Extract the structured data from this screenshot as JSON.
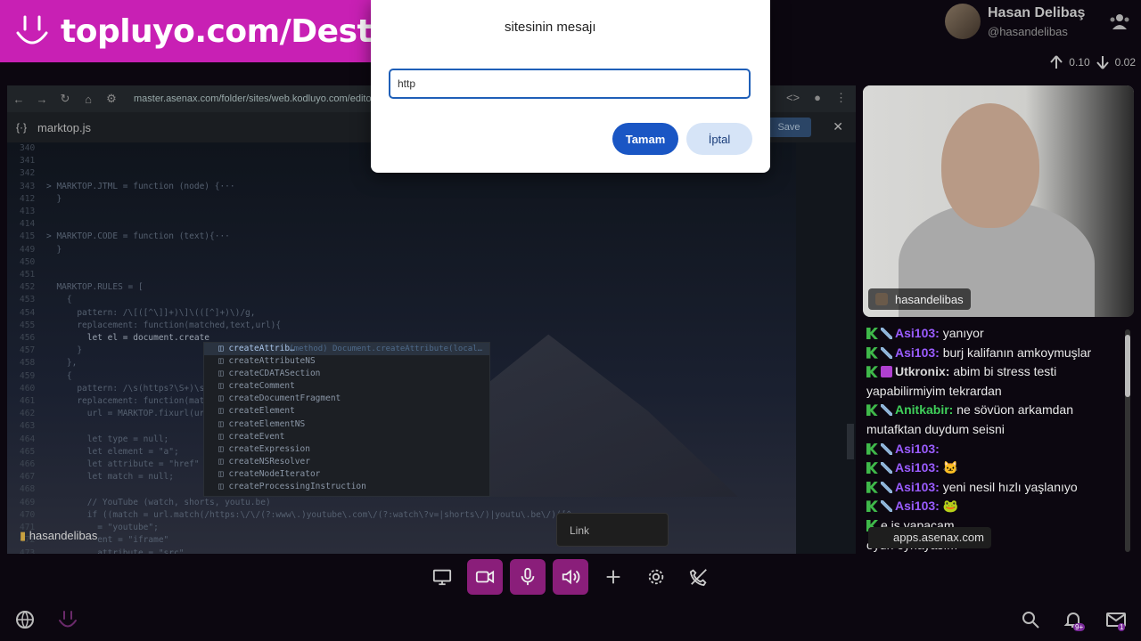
{
  "brand": {
    "url": "topluyo.com/Destek"
  },
  "user": {
    "name": "Hasan Delibaş",
    "handle": "@hasandelibas"
  },
  "stats": {
    "upload": "0.10",
    "download": "0.02"
  },
  "browser": {
    "address": "master.asenax.com/folder/sites/web.kodluyo.com/editor"
  },
  "editor": {
    "filename": "marktop.js",
    "save_label": "Save",
    "code_lines": [
      {
        "n": "340",
        "t": ""
      },
      {
        "n": "341",
        "t": ""
      },
      {
        "n": "342",
        "t": ""
      },
      {
        "n": "343",
        "t": "> MARKTOP.JTML = function (node) {···"
      },
      {
        "n": "412",
        "t": "  }"
      },
      {
        "n": "413",
        "t": ""
      },
      {
        "n": "414",
        "t": ""
      },
      {
        "n": "415",
        "t": "> MARKTOP.CODE = function (text){···"
      },
      {
        "n": "449",
        "t": "  }"
      },
      {
        "n": "450",
        "t": ""
      },
      {
        "n": "451",
        "t": ""
      },
      {
        "n": "452",
        "t": "  MARKTOP.RULES = ["
      },
      {
        "n": "453",
        "t": "    {"
      },
      {
        "n": "454",
        "t": "      pattern: /\\[([^\\]]+)\\]\\(([^]+)\\)/g,"
      },
      {
        "n": "455",
        "t": "      replacement: function(matched,text,url){"
      },
      {
        "n": "456",
        "t": "        let el = document.create"
      },
      {
        "n": "457",
        "t": "      }"
      },
      {
        "n": "458",
        "t": "    },"
      },
      {
        "n": "459",
        "t": "    {"
      },
      {
        "n": "460",
        "t": "      pattern: /\\s(https?\\S+)\\s"
      },
      {
        "n": "461",
        "t": "      replacement: function(match"
      },
      {
        "n": "462",
        "t": "        url = MARKTOP.fixurl(url"
      },
      {
        "n": "463",
        "t": ""
      },
      {
        "n": "464",
        "t": "        let type = null;"
      },
      {
        "n": "465",
        "t": "        let element = \"a\";"
      },
      {
        "n": "466",
        "t": "        let attribute = \"href\""
      },
      {
        "n": "467",
        "t": "        let match = null;"
      },
      {
        "n": "468",
        "t": ""
      },
      {
        "n": "469",
        "t": "        // YouTube (watch, shorts, youtu.be)"
      },
      {
        "n": "470",
        "t": "        if ((match = url.match(/https:\\/\\/(?:www\\.)youtube\\.com\\/(?:watch\\?v=|shorts\\/)|youtu\\.be\\/)([^"
      },
      {
        "n": "471",
        "t": "          = \"youtube\";"
      },
      {
        "n": "472",
        "t": "          ent = \"iframe\""
      },
      {
        "n": "473",
        "t": "          attribute = \"src\""
      }
    ],
    "suggestions": [
      "createAttrib…",
      "createAttributeNS",
      "createCDATASection",
      "createComment",
      "createDocumentFragment",
      "createElement",
      "createElementNS",
      "createEvent",
      "createExpression",
      "createNSResolver",
      "createNodeIterator",
      "createProcessingInstruction"
    ],
    "suggestion_meta": "(method) Document.createAttribute(local…"
  },
  "share_label": "hasandelibas",
  "dialog": {
    "title": "sitesinin mesajı",
    "input_value": "http",
    "ok_label": "Tamam",
    "cancel_label": "İptal"
  },
  "cam_label": "hasandelibas",
  "chat": [
    {
      "user": "Asi103",
      "color": "#9a5cff",
      "badges": [
        "green",
        "sword"
      ],
      "text": "yanıyor"
    },
    {
      "user": "Asi103",
      "color": "#9a5cff",
      "badges": [
        "green",
        "sword"
      ],
      "text": "burj kalifanın amkoymuşlar"
    },
    {
      "user": "Utkronix",
      "color": "#d8d8d8",
      "badges": [
        "green",
        "purple"
      ],
      "text": "abim bi stress testi yapabilirmiyim tekrardan"
    },
    {
      "user": "Anitkabir",
      "color": "#3fcf5a",
      "badges": [
        "green",
        "sword"
      ],
      "text": "ne sövüon arkamdan mutafktan duydum seisni"
    },
    {
      "user": "Asi103",
      "color": "#9a5cff",
      "badges": [
        "green",
        "sword"
      ],
      "text": ""
    },
    {
      "user": "Asi103",
      "color": "#9a5cff",
      "badges": [
        "green",
        "sword"
      ],
      "text": "🐱"
    },
    {
      "user": "Asi103",
      "color": "#9a5cff",
      "badges": [
        "green",
        "sword"
      ],
      "text": "yeni nesil hızlı yaşlanıyo"
    },
    {
      "user": "Asi103",
      "color": "#9a5cff",
      "badges": [
        "green",
        "sword"
      ],
      "text": "🐸"
    },
    {
      "user": "",
      "color": "#9a5cff",
      "badges": [
        "green"
      ],
      "text": "e is yapacam"
    },
    {
      "user": "",
      "color": "#9a5cff",
      "badges": [],
      "text": "oyun oynayasım"
    }
  ],
  "link_tooltip": "Link",
  "app_tooltip": "apps.asenax.com",
  "notifications": {
    "count": "9+",
    "mail_count": "1"
  }
}
